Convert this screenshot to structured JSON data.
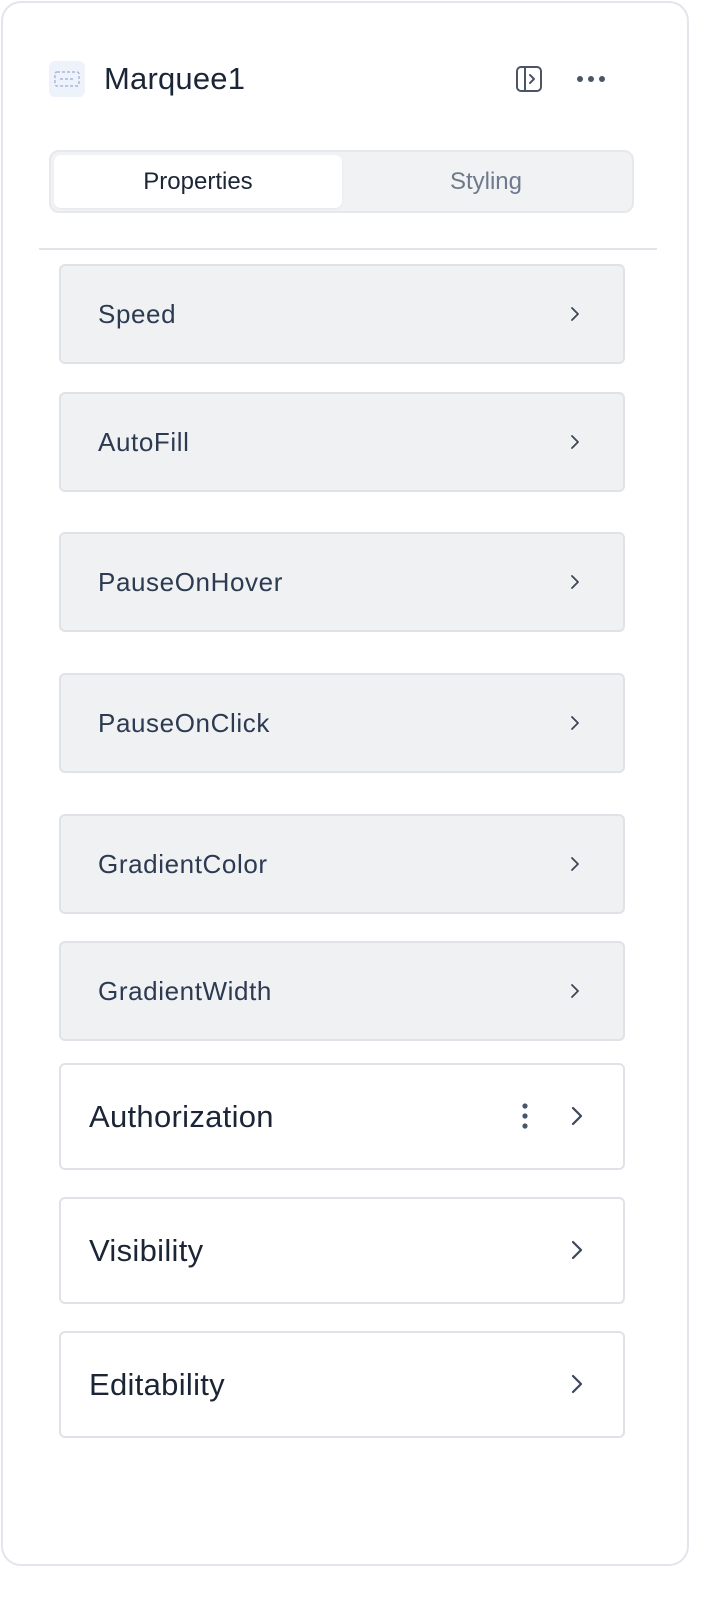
{
  "header": {
    "component_icon": "marquee-component-icon",
    "title": "Marquee1",
    "collapse_icon": "panel-collapse-icon",
    "more_icon": "more-horizontal-icon"
  },
  "tabs": [
    {
      "label": "Properties",
      "active": true
    },
    {
      "label": "Styling",
      "active": false
    }
  ],
  "properties": [
    {
      "label": "Speed"
    },
    {
      "label": "AutoFill"
    },
    {
      "label": "PauseOnHover"
    },
    {
      "label": "PauseOnClick"
    },
    {
      "label": "GradientColor"
    },
    {
      "label": "GradientWidth"
    }
  ],
  "sections": [
    {
      "label": "Authorization",
      "has_menu": true
    },
    {
      "label": "Visibility",
      "has_menu": false
    },
    {
      "label": "Editability",
      "has_menu": false
    }
  ],
  "colors": {
    "panel_border": "#e2e5ea",
    "row_bg": "#f0f1f3",
    "text_primary": "#1b2536",
    "text_muted": "#6e7a8c"
  }
}
